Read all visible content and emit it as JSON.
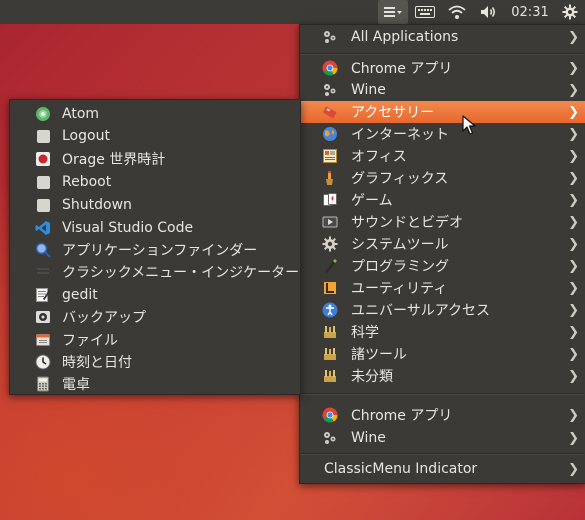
{
  "panel": {
    "clock": "02:31"
  },
  "main_menu": {
    "items": [
      {
        "label": "All Applications",
        "icon": "apps-icon"
      },
      {
        "label": "Chrome アプリ",
        "icon": "chrome-icon"
      },
      {
        "label": "Wine",
        "icon": "wine-icon"
      },
      {
        "label": "アクセサリー",
        "icon": "accessories-icon"
      },
      {
        "label": "インターネット",
        "icon": "internet-icon"
      },
      {
        "label": "オフィス",
        "icon": "office-icon"
      },
      {
        "label": "グラフィックス",
        "icon": "graphics-icon"
      },
      {
        "label": "ゲーム",
        "icon": "games-icon"
      },
      {
        "label": "サウンドとビデオ",
        "icon": "sound-video-icon"
      },
      {
        "label": "システムツール",
        "icon": "system-tools-icon"
      },
      {
        "label": "プログラミング",
        "icon": "programming-icon"
      },
      {
        "label": "ユーティリティ",
        "icon": "utilities-icon"
      },
      {
        "label": "ユニバーサルアクセス",
        "icon": "accessibility-icon"
      },
      {
        "label": "科学",
        "icon": "science-icon"
      },
      {
        "label": "諸ツール",
        "icon": "other-tools-icon"
      },
      {
        "label": "未分類",
        "icon": "uncategorized-icon"
      },
      {
        "label": "Chrome アプリ",
        "icon": "chrome-icon"
      },
      {
        "label": "Wine",
        "icon": "wine-icon"
      },
      {
        "label": "ClassicMenu Indicator",
        "icon": ""
      }
    ]
  },
  "submenu": {
    "items": [
      {
        "label": "Atom",
        "icon": "atom-icon"
      },
      {
        "label": "Logout",
        "icon": "logout-icon"
      },
      {
        "label": "Orage 世界時計",
        "icon": "orage-icon"
      },
      {
        "label": "Reboot",
        "icon": "reboot-icon"
      },
      {
        "label": "Shutdown",
        "icon": "shutdown-icon"
      },
      {
        "label": "Visual Studio Code",
        "icon": "vscode-icon"
      },
      {
        "label": "アプリケーションファインダー",
        "icon": "app-finder-icon"
      },
      {
        "label": "クラシックメニュー・インジケーター",
        "icon": "classicmenu-icon"
      },
      {
        "label": "gedit",
        "icon": "gedit-icon"
      },
      {
        "label": "バックアップ",
        "icon": "backup-icon"
      },
      {
        "label": "ファイル",
        "icon": "files-icon"
      },
      {
        "label": "時刻と日付",
        "icon": "clock-icon"
      },
      {
        "label": "電卓",
        "icon": "calculator-icon"
      }
    ]
  },
  "colors": {
    "highlight": "#ee7a3e",
    "menu_bg": "#3b3a37",
    "panel_bg": "#3c3b37"
  }
}
